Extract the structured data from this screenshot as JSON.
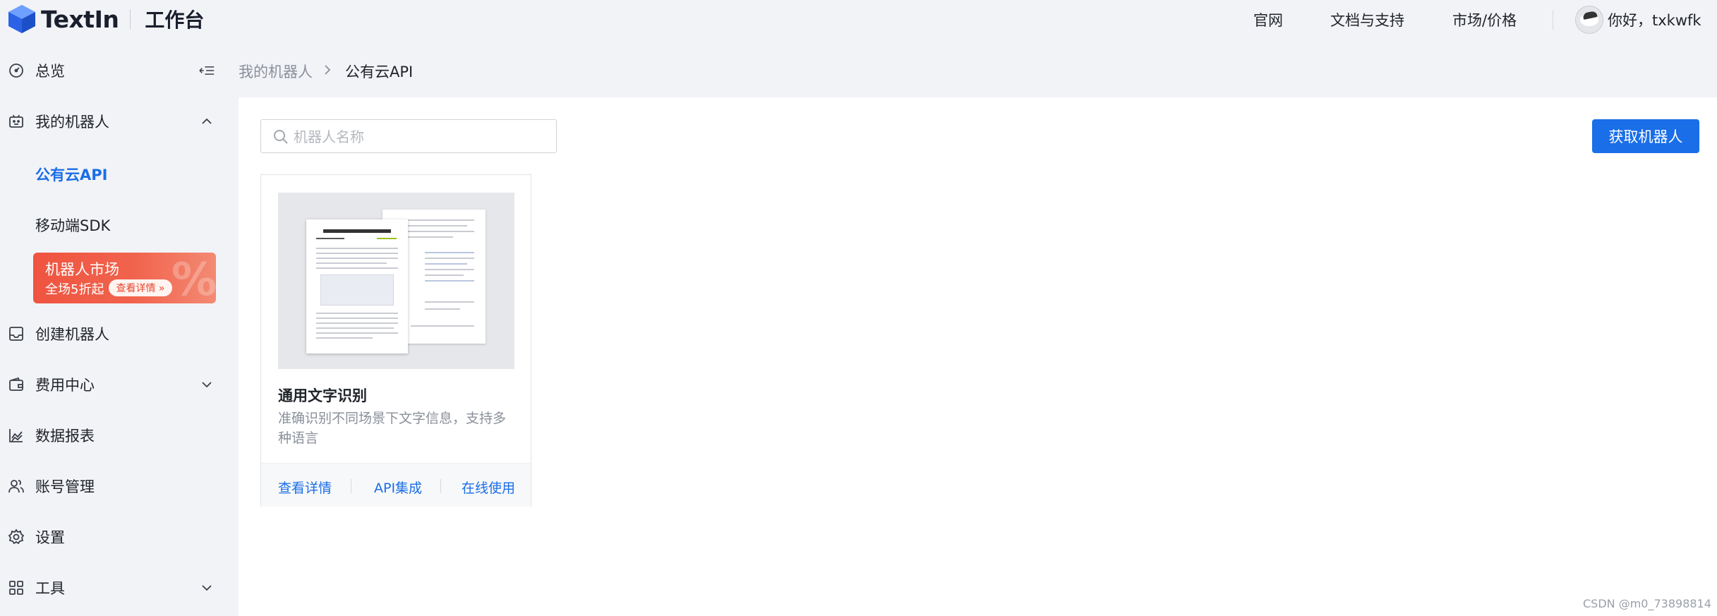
{
  "app": {
    "logo_text": "TextIn",
    "logo_subtitle": "工作台"
  },
  "topnav": {
    "links": [
      "官网",
      "文档与支持",
      "市场/价格"
    ],
    "greeting": "你好，txkwfk"
  },
  "sidebar": {
    "items": [
      {
        "label": "总览",
        "icon": "dashboard-icon"
      },
      {
        "label": "我的机器人",
        "icon": "robot-icon",
        "expanded": true
      },
      {
        "label": "创建机器人",
        "icon": "inbox-icon"
      },
      {
        "label": "费用中心",
        "icon": "wallet-icon",
        "expandable": true
      },
      {
        "label": "数据报表",
        "icon": "chart-icon"
      },
      {
        "label": "账号管理",
        "icon": "users-icon"
      },
      {
        "label": "设置",
        "icon": "gear-icon"
      },
      {
        "label": "工具",
        "icon": "grid-icon",
        "expandable": true
      }
    ],
    "subitems": [
      {
        "label": "公有云API",
        "active": true
      },
      {
        "label": "移动端SDK",
        "active": false
      }
    ],
    "promo": {
      "title": "机器人市场",
      "subtitle": "全场5折起",
      "button": "查看详情 »"
    }
  },
  "breadcrumb": {
    "parent": "我的机器人",
    "separator": ">",
    "current": "公有云API"
  },
  "main": {
    "search_placeholder": "机器人名称",
    "primary_button": "获取机器人",
    "cards": [
      {
        "title": "通用文字识别",
        "description": "准确识别不同场景下文字信息，支持多种语言",
        "actions": [
          "查看详情",
          "API集成",
          "在线使用"
        ]
      }
    ]
  },
  "watermark": "CSDN @m0_73898814",
  "colors": {
    "accent": "#1a6ee8",
    "sidebar_bg": "#f2f3f7",
    "promo": "#ef5440"
  }
}
